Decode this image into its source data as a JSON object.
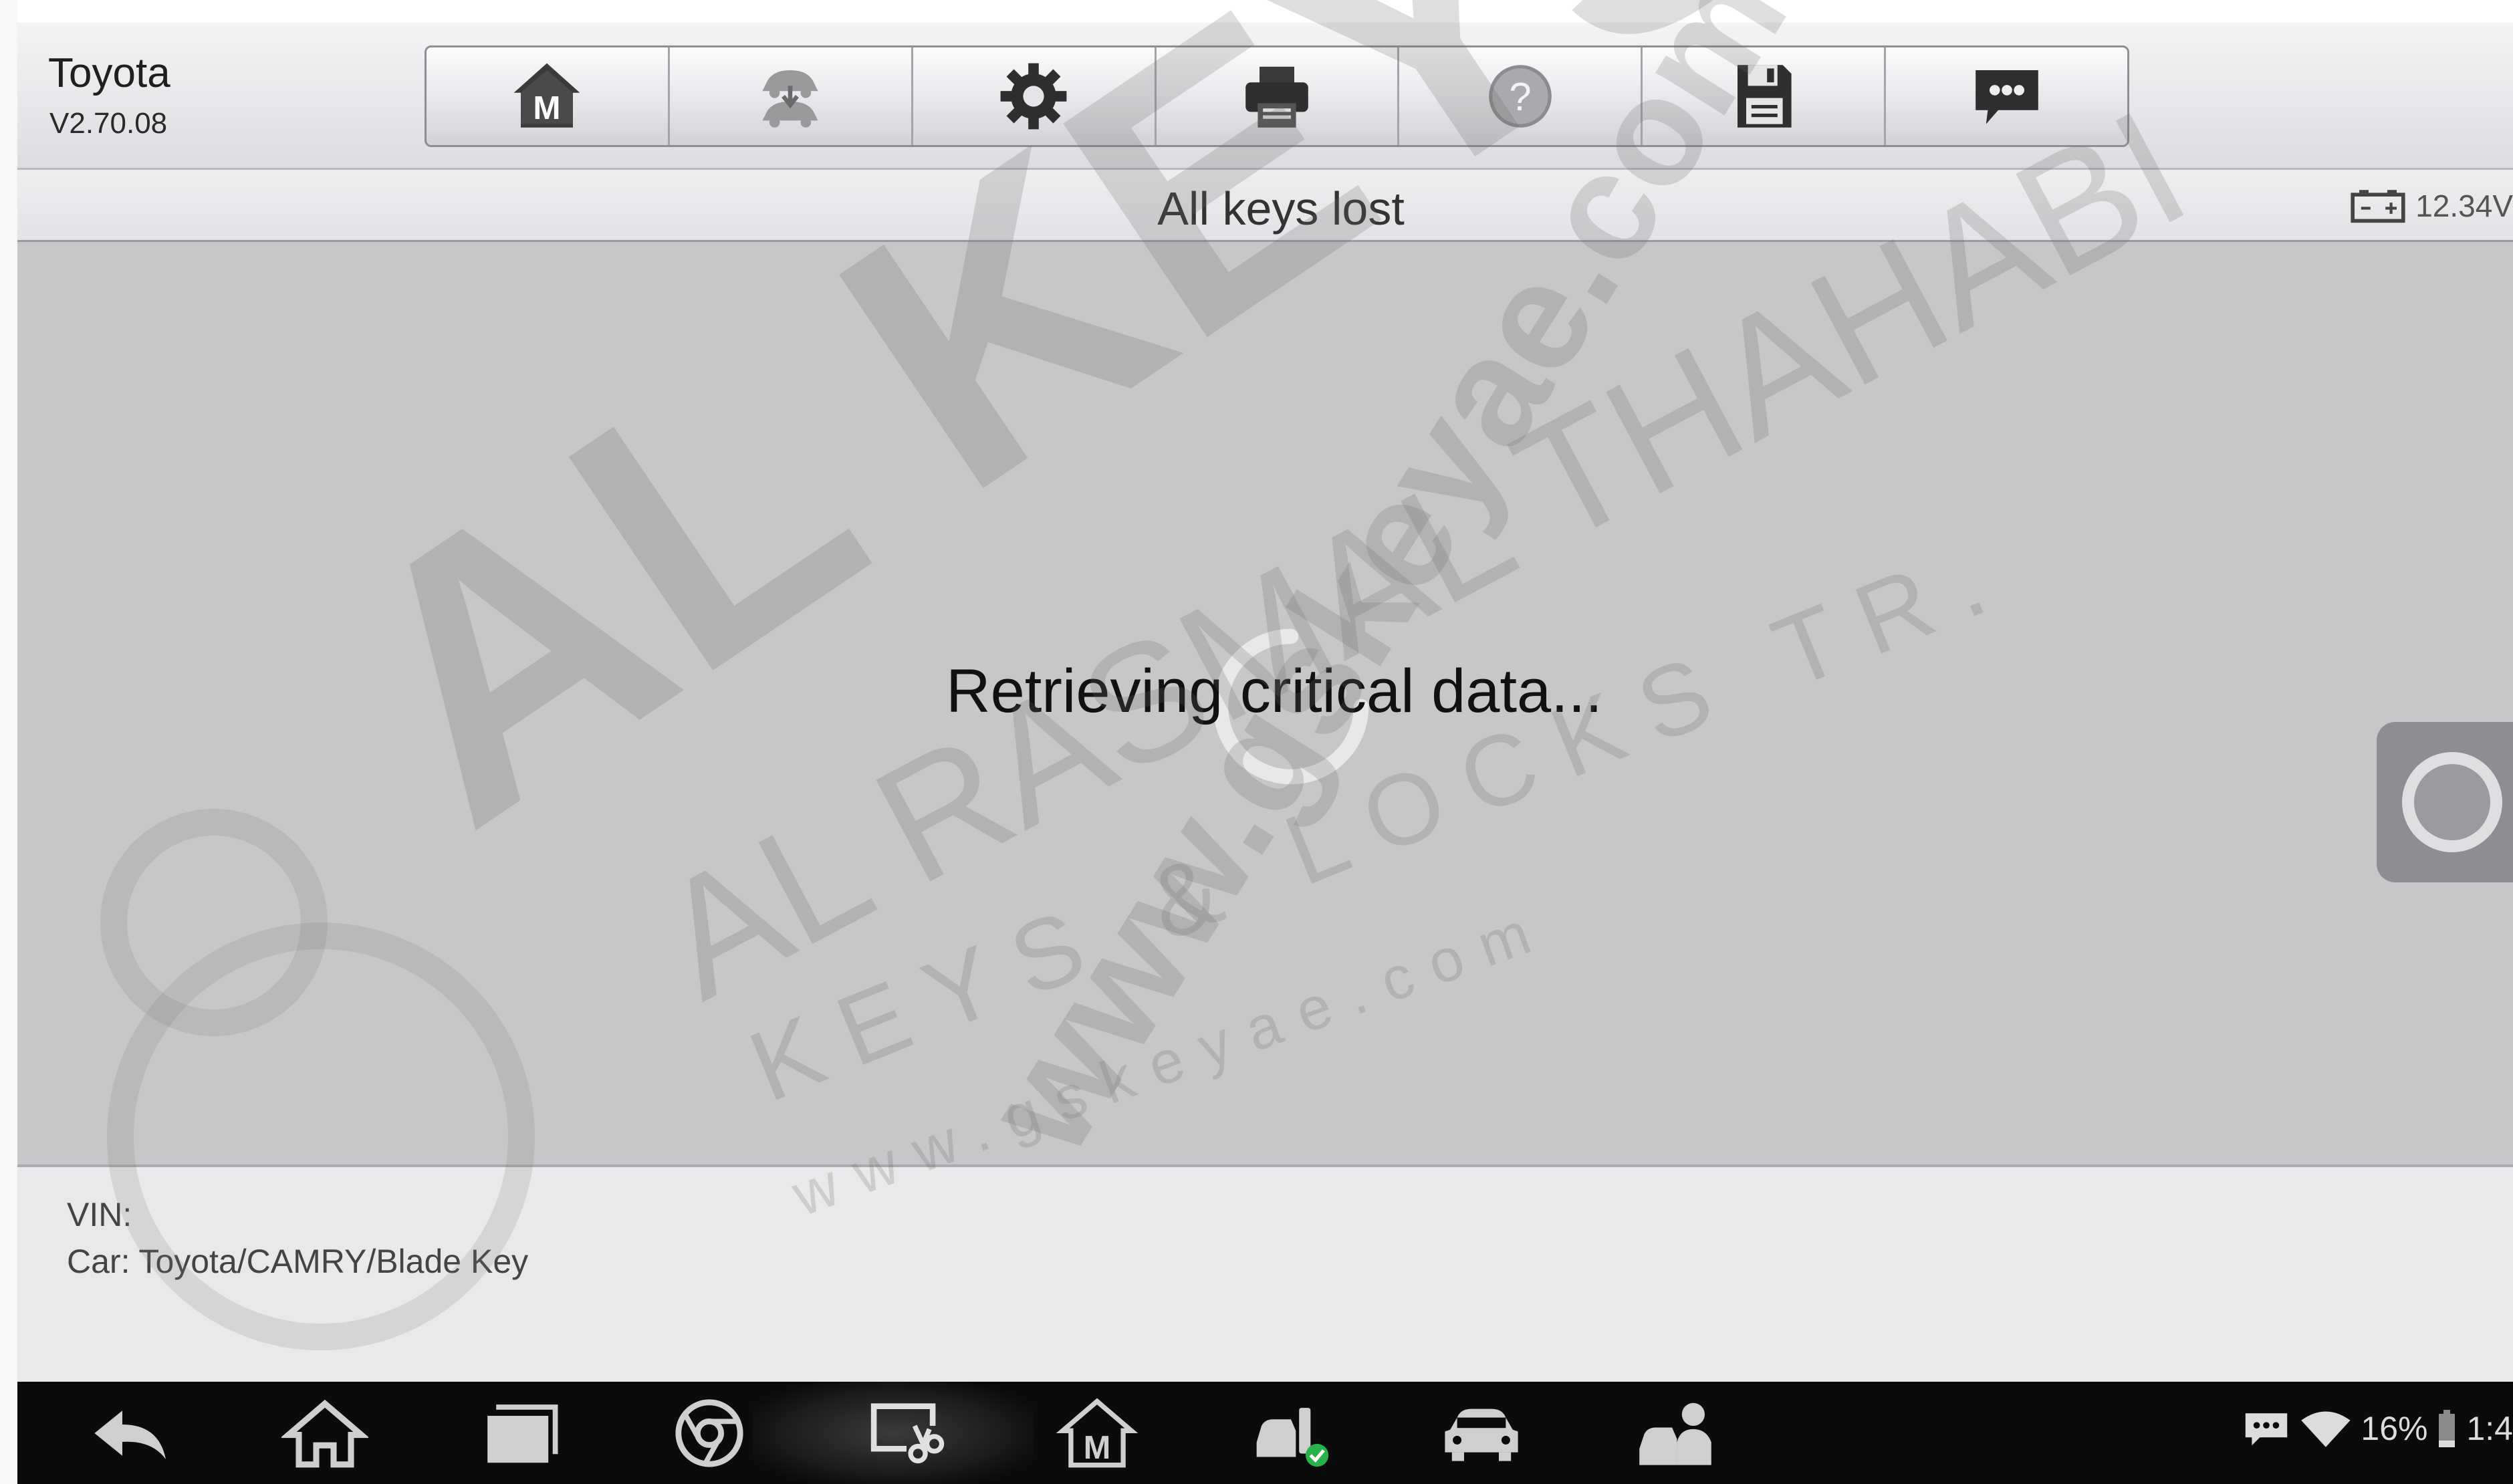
{
  "header": {
    "app_name": "Toyota",
    "app_version": "V2.70.08",
    "toolbar": [
      {
        "name": "home",
        "icon": "home-m-icon"
      },
      {
        "name": "vehicle-swap",
        "icon": "vehicle-swap-icon"
      },
      {
        "name": "settings",
        "icon": "gear-icon"
      },
      {
        "name": "print",
        "icon": "printer-icon"
      },
      {
        "name": "help",
        "icon": "help-icon"
      },
      {
        "name": "save",
        "icon": "save-icon"
      },
      {
        "name": "feedback",
        "icon": "chat-icon"
      }
    ]
  },
  "titlebar": {
    "title": "All keys lost",
    "battery_icon": "battery-icon",
    "voltage": "12.34V"
  },
  "content": {
    "status_text": "Retrieving critical data...",
    "spinner_icon": "loading-spinner-icon",
    "floating_button_icon": "floating-circle-icon"
  },
  "info": {
    "vin": "VIN:",
    "car": "Car: Toyota/CAMRY/Blade Key"
  },
  "navbar": {
    "buttons": [
      "back-icon",
      "home-icon",
      "recent-apps-icon",
      "chrome-icon",
      "screen-capture-icon",
      "maxisys-home-icon",
      "vehicle-diagnose-icon",
      "car-icon",
      "car-service-icon"
    ],
    "status": {
      "battery_percent": "16%",
      "time": "1:4"
    }
  },
  "watermark": {
    "lines": [
      "AL KEYS",
      "AL RASMAL THAHABI",
      "KEYS & LOCKS TR.",
      "www.gskeyae.com",
      "www.gskeyae.com"
    ]
  },
  "colors": {
    "content_bg": "#c6c7c9",
    "nav_bg": "#0b0b0b",
    "header_bg": "#e6e7ea"
  }
}
